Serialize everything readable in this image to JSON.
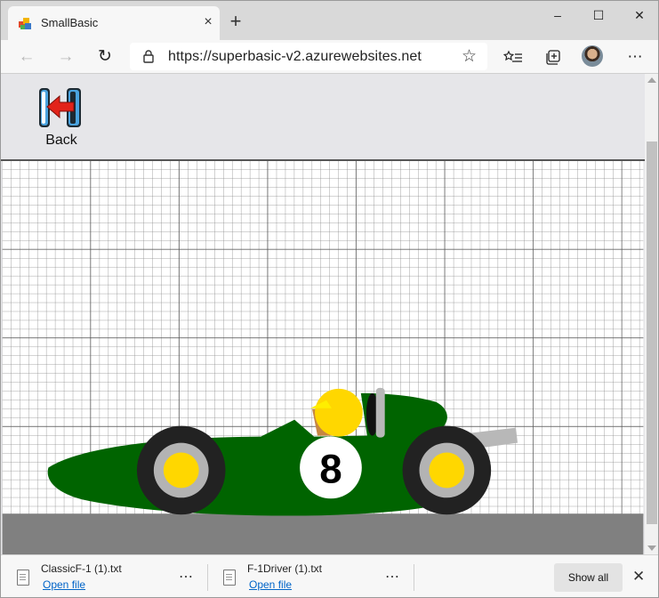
{
  "browser": {
    "tab_title": "SmallBasic",
    "tab_close_icon": "×",
    "new_tab_icon": "+",
    "window_controls": {
      "minimize": "–",
      "maximize": "☐",
      "close": "✕"
    },
    "nav": {
      "back_icon": "←",
      "forward_icon": "→",
      "refresh_icon": "↻"
    },
    "url": "https://superbasic-v2.azurewebsites.net",
    "favorite_icon": "☆",
    "menu_icon": "⋯"
  },
  "page": {
    "back_label": "Back",
    "car": {
      "body_color": "#006400",
      "number": "8",
      "helmet_color": "#FFD700",
      "wheel_hub_color": "#FFD700",
      "tire_color": "#222222",
      "ground_color": "#808080"
    }
  },
  "downloads": {
    "items": [
      {
        "name": "ClassicF-1 (1).txt",
        "action": "Open file"
      },
      {
        "name": "F-1Driver (1).txt",
        "action": "Open file"
      }
    ],
    "more_icon": "⋯",
    "show_all": "Show all",
    "close_icon": "✕"
  }
}
